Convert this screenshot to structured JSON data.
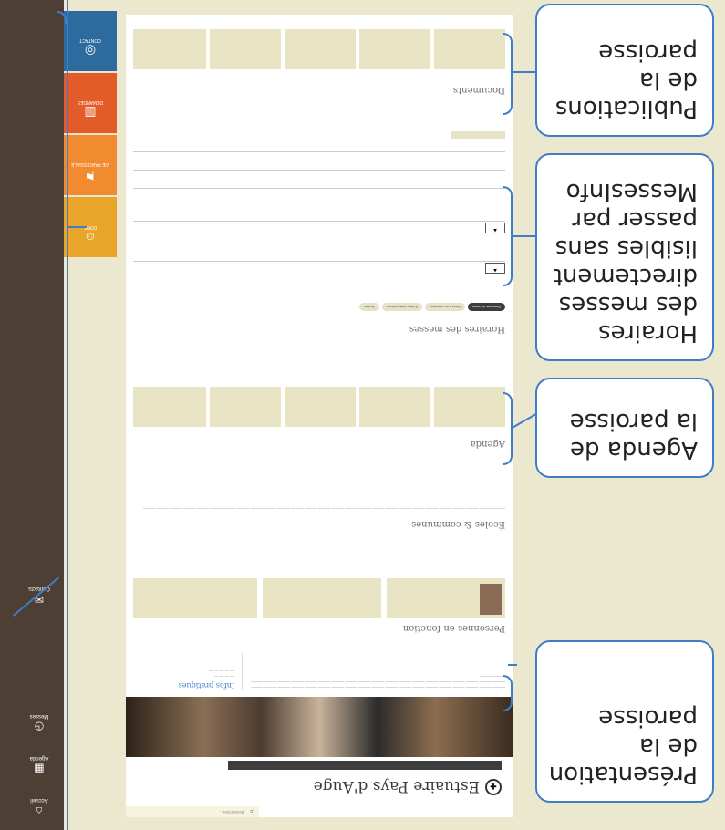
{
  "callouts": {
    "publications": "Publications de la paroisse",
    "horaires": "Horaires des messes directement lisibles sans passer par MessesInfo",
    "agenda": "Agenda de la paroisse",
    "presentation": "Présentation de la paroisse"
  },
  "site": {
    "name": "Estuaire Pays d'Auge",
    "nav": [
      "PAROISSE ET VIE",
      "DEMANDES",
      "DONS",
      "HORAIRES DE MESSES",
      "DOCUMENTS"
    ],
    "search_placeholder": "Rechercher…"
  },
  "sections": {
    "personnes": "Personnes en fonction",
    "ecoles": "Écoles & communes",
    "agenda": "Agenda",
    "horaires": "Horaires des messes",
    "documents": "Documents",
    "infos": "Infos pratiques"
  },
  "horaires_filters": [
    "Semaine de base",
    "Messe en semaine",
    "Autres célébrations",
    "Toutes"
  ],
  "sidebar": {
    "items": [
      "Accueil",
      "Agenda",
      "Messes",
      "Contacts",
      "Paroisse"
    ]
  },
  "tiles": [
    "DONS",
    "VIE PAROISSIALE",
    "DEMANDES",
    "CONTACT"
  ],
  "colors": {
    "accent": "#3f7ec6",
    "sidebar": "#4e3f35",
    "card": "#e8e4c4"
  }
}
